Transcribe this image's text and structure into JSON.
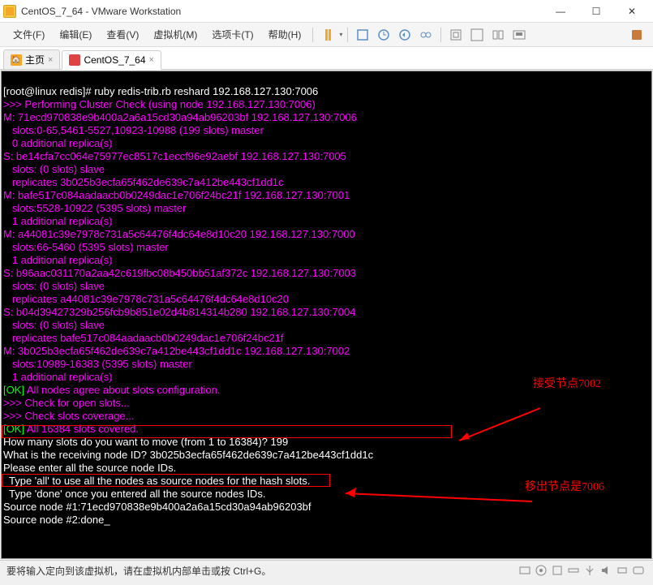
{
  "window": {
    "title": "CentOS_7_64 - VMware Workstation",
    "min": "—",
    "max": "☐",
    "close": "✕"
  },
  "menu": {
    "file": "文件(F)",
    "edit": "编辑(E)",
    "view": "查看(V)",
    "vm": "虚拟机(M)",
    "tabs": "选项卡(T)",
    "help": "帮助(H)"
  },
  "tabs": {
    "home": "主页",
    "vm": "CentOS_7_64"
  },
  "term": {
    "l1": "[root@linux redis]# ruby redis-trib.rb reshard 192.168.127.130:7006",
    "l2": ">>> Performing Cluster Check (using node 192.168.127.130:7006)",
    "l3": "M: 71ecd970838e9b400a2a6a15cd30a94ab96203bf 192.168.127.130:7006",
    "l4": "   slots:0-65,5461-5527,10923-10988 (199 slots) master",
    "l5": "   0 additional replica(s)",
    "l6": "S: be14cfa7cc064e75977ec8517c1eccf96e92aebf 192.168.127.130:7005",
    "l7": "   slots: (0 slots) slave",
    "l8": "   replicates 3b025b3ecfa65f462de639c7a412be443cf1dd1c",
    "l9": "M: bafe517c084aadaacb0b0249dac1e706f24bc21f 192.168.127.130:7001",
    "l10": "   slots:5528-10922 (5395 slots) master",
    "l11": "   1 additional replica(s)",
    "l12": "M: a44081c39e7978c731a5c64476f4dc64e8d10c20 192.168.127.130:7000",
    "l13": "   slots:66-5460 (5395 slots) master",
    "l14": "   1 additional replica(s)",
    "l15": "S: b96aac031170a2aa42c619fbc08b450bb51af372c 192.168.127.130:7003",
    "l16": "   slots: (0 slots) slave",
    "l17": "   replicates a44081c39e7978c731a5c64476f4dc64e8d10c20",
    "l18": "S: b04d39427329b256fcb9b851e02d4b814314b280 192.168.127.130:7004",
    "l19": "   slots: (0 slots) slave",
    "l20": "   replicates bafe517c084aadaacb0b0249dac1e706f24bc21f",
    "l21": "M: 3b025b3ecfa65f462de639c7a412be443cf1dd1c 192.168.127.130:7002",
    "l22": "   slots:10989-16383 (5395 slots) master",
    "l23": "   1 additional replica(s)",
    "l24a": "[OK] ",
    "l24b": "All nodes agree about slots configuration.",
    "l25": ">>> Check for open slots...",
    "l26": ">>> Check slots coverage...",
    "l27a": "[OK] ",
    "l27b": "All 16384 slots covered.",
    "l28": "How many slots do you want to move (from 1 to 16384)? 199",
    "l29": "What is the receiving node ID? 3b025b3ecfa65f462de639c7a412be443cf1dd1c",
    "l30": "Please enter all the source node IDs.",
    "l31": "  Type 'all' to use all the nodes as source nodes for the hash slots.",
    "l32": "  Type 'done' once you entered all the source nodes IDs.",
    "l33": "Source node #1:71ecd970838e9b400a2a6a15cd30a94ab96203bf",
    "l34": "Source node #2:done_"
  },
  "annotations": {
    "a1": "接受节点7002",
    "a2": "移出节点是7006"
  },
  "status": {
    "text": "要将输入定向到该虚拟机，请在虚拟机内部单击或按 Ctrl+G。"
  }
}
